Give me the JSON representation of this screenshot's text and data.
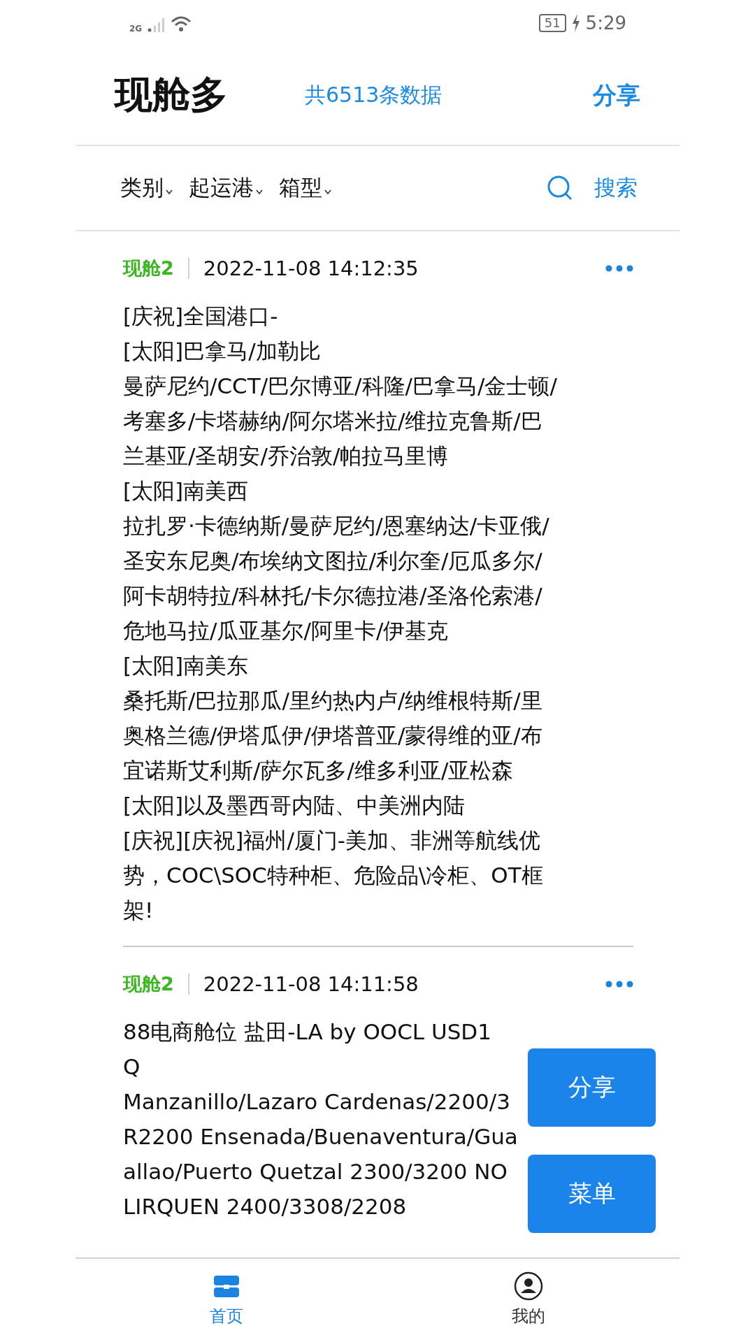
{
  "status_bar": {
    "network": "2G",
    "battery": "51",
    "time": "5:29"
  },
  "header": {
    "title": "现舱多",
    "count": "共6513条数据",
    "share": "分享"
  },
  "filters": [
    {
      "label": "类别"
    },
    {
      "label": "起运港"
    },
    {
      "label": "箱型"
    }
  ],
  "search": {
    "label": "搜索"
  },
  "posts": [
    {
      "tag": "现舱2",
      "time": "2022-11-08 14:12:35",
      "lines": [
        "[庆祝]全国港口-",
        "[太阳]巴拿马/加勒比",
        "曼萨尼约/CCT/巴尔博亚/科隆/巴拿马/金士顿/",
        "考塞多/卡塔赫纳/阿尔塔米拉/维拉克鲁斯/巴",
        "兰基亚/圣胡安/乔治敦/帕拉马里博",
        "[太阳]南美西",
        "拉扎罗·卡德纳斯/曼萨尼约/恩塞纳达/卡亚俄/",
        "圣安东尼奥/布埃纳文图拉/利尔奎/厄瓜多尔/",
        "阿卡胡特拉/科林托/卡尔德拉港/圣洛伦索港/",
        "危地马拉/瓜亚基尔/阿里卡/伊基克",
        "[太阳]南美东",
        "桑托斯/巴拉那瓜/里约热内卢/纳维根特斯/里",
        "奥格兰德/伊塔瓜伊/伊塔普亚/蒙得维的亚/布",
        "宜诺斯艾利斯/萨尔瓦多/维多利亚/亚松森",
        "[太阳]以及墨西哥内陆、中美洲内陆",
        "[庆祝][庆祝]福州/厦门-美加、非洲等航线优",
        "势，COC\\SOC特种柜、危险品\\冷柜、OT框",
        "架!"
      ]
    },
    {
      "tag": "现舱2",
      "time": "2022-11-08 14:11:58",
      "lines": [
        "88电商舱位 盐田-LA by OOCL USD1",
        "Q",
        "Manzanillo/Lazaro Cardenas/2200/3",
        "R2200 Ensenada/Buenaventura/Gua",
        "allao/Puerto Quetzal 2300/3200 NO",
        "LIRQUEN 2400/3308/2208"
      ]
    }
  ],
  "float_buttons": [
    {
      "label": "分享"
    },
    {
      "label": "菜单"
    }
  ],
  "tabs": [
    {
      "label": "首页",
      "kind": "home",
      "selected": true
    },
    {
      "label": "我的",
      "kind": "profile",
      "selected": false
    }
  ]
}
